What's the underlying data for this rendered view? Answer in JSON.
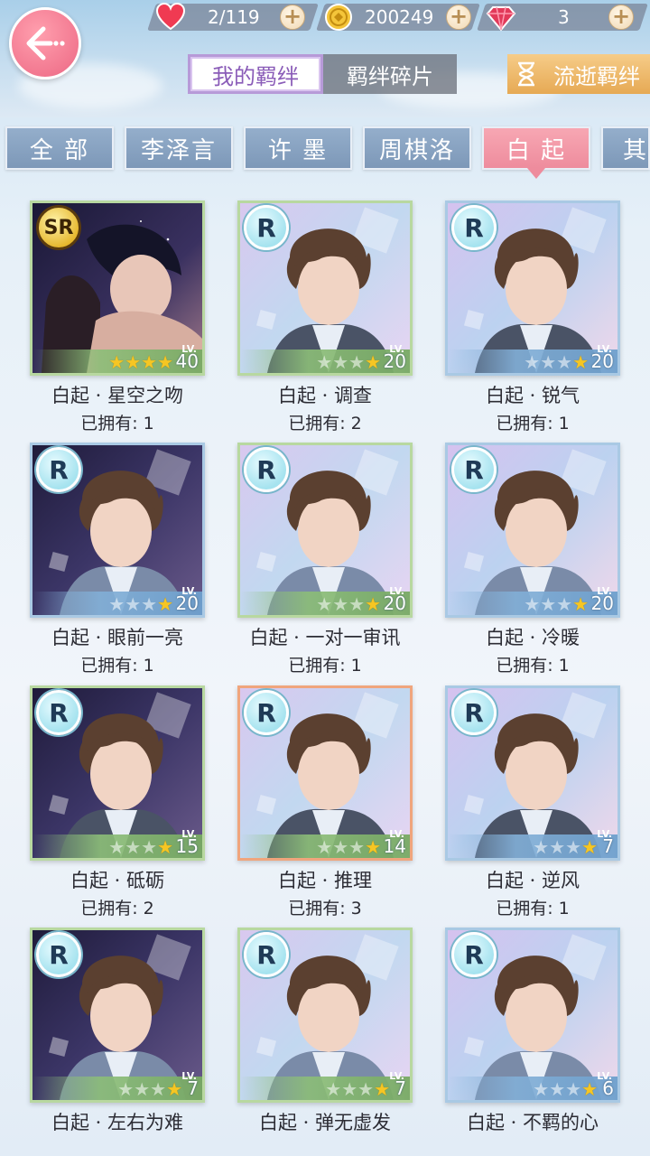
{
  "header": {
    "resources": [
      {
        "icon": "heart-icon",
        "value": "2/119"
      },
      {
        "icon": "gold-coin-icon",
        "value": "200249"
      },
      {
        "icon": "diamond-icon",
        "value": "3"
      }
    ]
  },
  "main_tabs": [
    {
      "label": "我的羁绊",
      "active": true
    },
    {
      "label": "羁绊碎片",
      "active": false
    },
    {
      "label": "流逝羁绊",
      "active": false
    }
  ],
  "filters": [
    {
      "label": "全 部"
    },
    {
      "label": "李泽言"
    },
    {
      "label": "许 墨"
    },
    {
      "label": "周棋洛"
    },
    {
      "label": "白 起",
      "selected": true
    },
    {
      "label": "其"
    }
  ],
  "cards": [
    {
      "rarity": "SR",
      "name": "白起 · 星空之吻",
      "owned": "已拥有: 1",
      "stars": 4,
      "stars_max": 4,
      "lv_label": "LV.",
      "level": "40"
    },
    {
      "rarity": "R",
      "name": "白起 · 调查",
      "owned": "已拥有: 2",
      "stars": 1,
      "stars_max": 4,
      "lv_label": "LV.",
      "level": "20"
    },
    {
      "rarity": "R",
      "name": "白起 · 锐气",
      "owned": "已拥有: 1",
      "stars": 1,
      "stars_max": 4,
      "lv_label": "LV.",
      "level": "20"
    },
    {
      "rarity": "R",
      "name": "白起 · 眼前一亮",
      "owned": "已拥有: 1",
      "stars": 1,
      "stars_max": 4,
      "lv_label": "LV.",
      "level": "20"
    },
    {
      "rarity": "R",
      "name": "白起 · 一对一审讯",
      "owned": "已拥有: 1",
      "stars": 1,
      "stars_max": 4,
      "lv_label": "LV.",
      "level": "20"
    },
    {
      "rarity": "R",
      "name": "白起 · 冷暖",
      "owned": "已拥有: 1",
      "stars": 1,
      "stars_max": 4,
      "lv_label": "LV.",
      "level": "20"
    },
    {
      "rarity": "R",
      "name": "白起 · 砥砺",
      "owned": "已拥有: 2",
      "stars": 1,
      "stars_max": 4,
      "lv_label": "LV.",
      "level": "15"
    },
    {
      "rarity": "R",
      "name": "白起 · 推理",
      "owned": "已拥有: 3",
      "stars": 1,
      "stars_max": 4,
      "lv_label": "LV.",
      "level": "14"
    },
    {
      "rarity": "R",
      "name": "白起 · 逆风",
      "owned": "已拥有: 1",
      "stars": 1,
      "stars_max": 4,
      "lv_label": "LV.",
      "level": "7"
    },
    {
      "rarity": "R",
      "name": "白起 · 左右为难",
      "owned": "",
      "stars": 1,
      "stars_max": 4,
      "lv_label": "LV.",
      "level": "7"
    },
    {
      "rarity": "R",
      "name": "白起 · 弹无虚发",
      "owned": "",
      "stars": 1,
      "stars_max": 4,
      "lv_label": "LV.",
      "level": "7"
    },
    {
      "rarity": "R",
      "name": "白起 · 不羁的心",
      "owned": "",
      "stars": 1,
      "stars_max": 4,
      "lv_label": "LV.",
      "level": "6"
    }
  ],
  "colors": {
    "accent_pink": "#ee8c9d",
    "accent_purple": "#8a5cb8",
    "filter_blue": "#7d98b8"
  }
}
